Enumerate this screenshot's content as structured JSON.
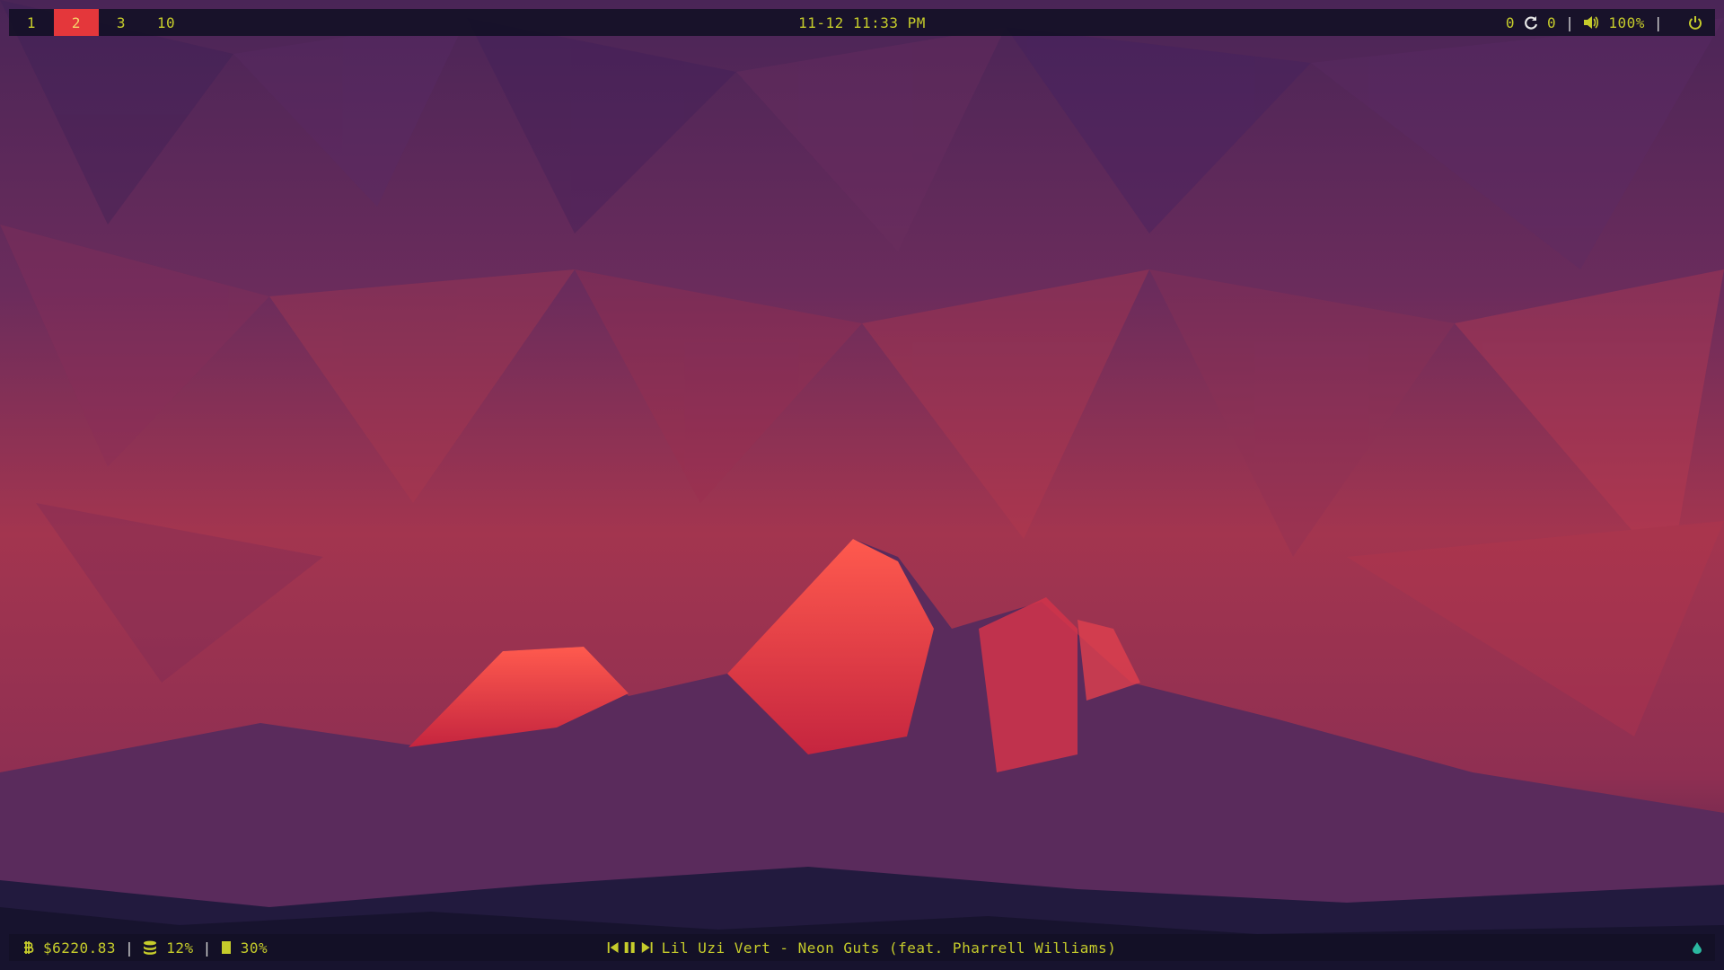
{
  "top_bar": {
    "workspaces": [
      {
        "label": "1",
        "active": false
      },
      {
        "label": "2",
        "active": true
      },
      {
        "label": "3",
        "active": false
      },
      {
        "label": "10",
        "active": false
      }
    ],
    "datetime": "11-12 11:33 PM",
    "updates_left": "0",
    "updates_right": "0",
    "volume": "100%",
    "separator": "|"
  },
  "bottom_bar": {
    "bitcoin_price": "$6220.83",
    "disk_usage": "12%",
    "memory_usage": "30%",
    "separator": "|",
    "now_playing": "Lil Uzi Vert - Neon Guts (feat. Pharrell Williams)"
  },
  "icons": {
    "bitcoin": "bitcoin-icon",
    "database": "database-icon",
    "memory": "memory-icon",
    "refresh": "refresh-icon",
    "volume": "volume-icon",
    "power": "power-icon",
    "previous": "previous-track-icon",
    "pause": "pause-icon",
    "next": "next-track-icon",
    "drop": "drop-icon"
  },
  "colors": {
    "bar_background": "#141026",
    "text_accent": "#c6cc2b",
    "active_workspace": "#e4373b",
    "drop_icon": "#2bb8a0"
  }
}
